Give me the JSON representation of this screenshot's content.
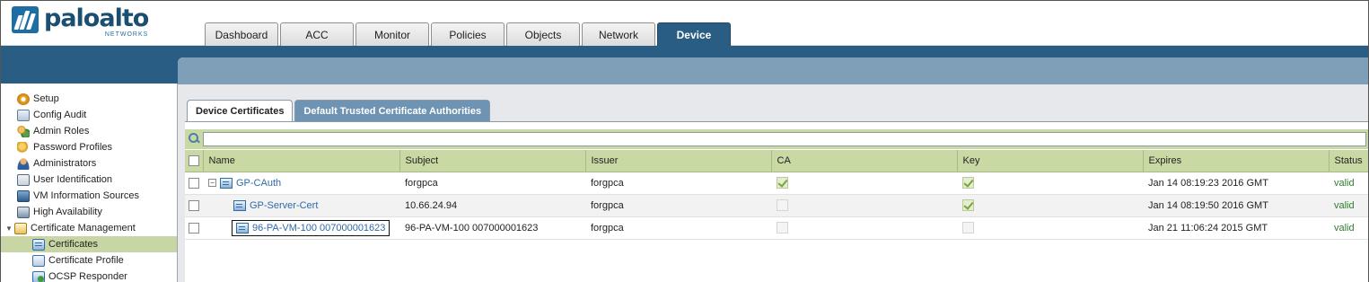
{
  "brand": {
    "name": "paloalto",
    "sub": "NETWORKS"
  },
  "tabs": [
    {
      "label": "Dashboard",
      "active": false
    },
    {
      "label": "ACC",
      "active": false
    },
    {
      "label": "Monitor",
      "active": false
    },
    {
      "label": "Policies",
      "active": false
    },
    {
      "label": "Objects",
      "active": false
    },
    {
      "label": "Network",
      "active": false
    },
    {
      "label": "Device",
      "active": true
    }
  ],
  "sidebar": {
    "items": [
      {
        "label": "Setup",
        "icon": "gear-icon"
      },
      {
        "label": "Config Audit",
        "icon": "config-audit-icon"
      },
      {
        "label": "Admin Roles",
        "icon": "admin-roles-icon"
      },
      {
        "label": "Password Profiles",
        "icon": "password-profiles-icon"
      },
      {
        "label": "Administrators",
        "icon": "administrators-icon"
      },
      {
        "label": "User Identification",
        "icon": "user-identification-icon"
      },
      {
        "label": "VM Information Sources",
        "icon": "vm-information-icon"
      },
      {
        "label": "High Availability",
        "icon": "high-availability-icon"
      },
      {
        "label": "Certificate Management",
        "icon": "certificate-management-icon",
        "expanded": true
      },
      {
        "label": "Certificates",
        "icon": "certificate-icon",
        "selected": true
      },
      {
        "label": "Certificate Profile",
        "icon": "certificate-profile-icon"
      },
      {
        "label": "OCSP Responder",
        "icon": "ocsp-responder-icon"
      }
    ]
  },
  "subtabs": [
    {
      "label": "Device Certificates",
      "active": true
    },
    {
      "label": "Default Trusted Certificate Authorities",
      "active": false
    }
  ],
  "filter": {
    "value": "",
    "placeholder": ""
  },
  "table": {
    "columns": [
      "Name",
      "Subject",
      "Issuer",
      "CA",
      "Key",
      "Expires",
      "Status"
    ],
    "rows": [
      {
        "name": "GP-CAuth",
        "subject": "forgpca",
        "issuer": "forgpca",
        "ca": true,
        "key": true,
        "expires": "Jan 14 08:19:23 2016 GMT",
        "status": "valid"
      },
      {
        "name": "GP-Server-Cert",
        "subject": "10.66.24.94",
        "issuer": "forgpca",
        "ca": false,
        "key": true,
        "expires": "Jan 14 08:19:50 2016 GMT",
        "status": "valid"
      },
      {
        "name": "96-PA-VM-100 007000001623",
        "subject": "96-PA-VM-100 007000001623",
        "issuer": "forgpca",
        "ca": false,
        "key": false,
        "expires": "Jan 21 11:06:24 2015 GMT",
        "status": "valid"
      }
    ]
  },
  "colors": {
    "accent": "#2a5d84",
    "header_green": "#c9d9a4",
    "link": "#2f6aa8",
    "valid": "#2f7d2f"
  }
}
